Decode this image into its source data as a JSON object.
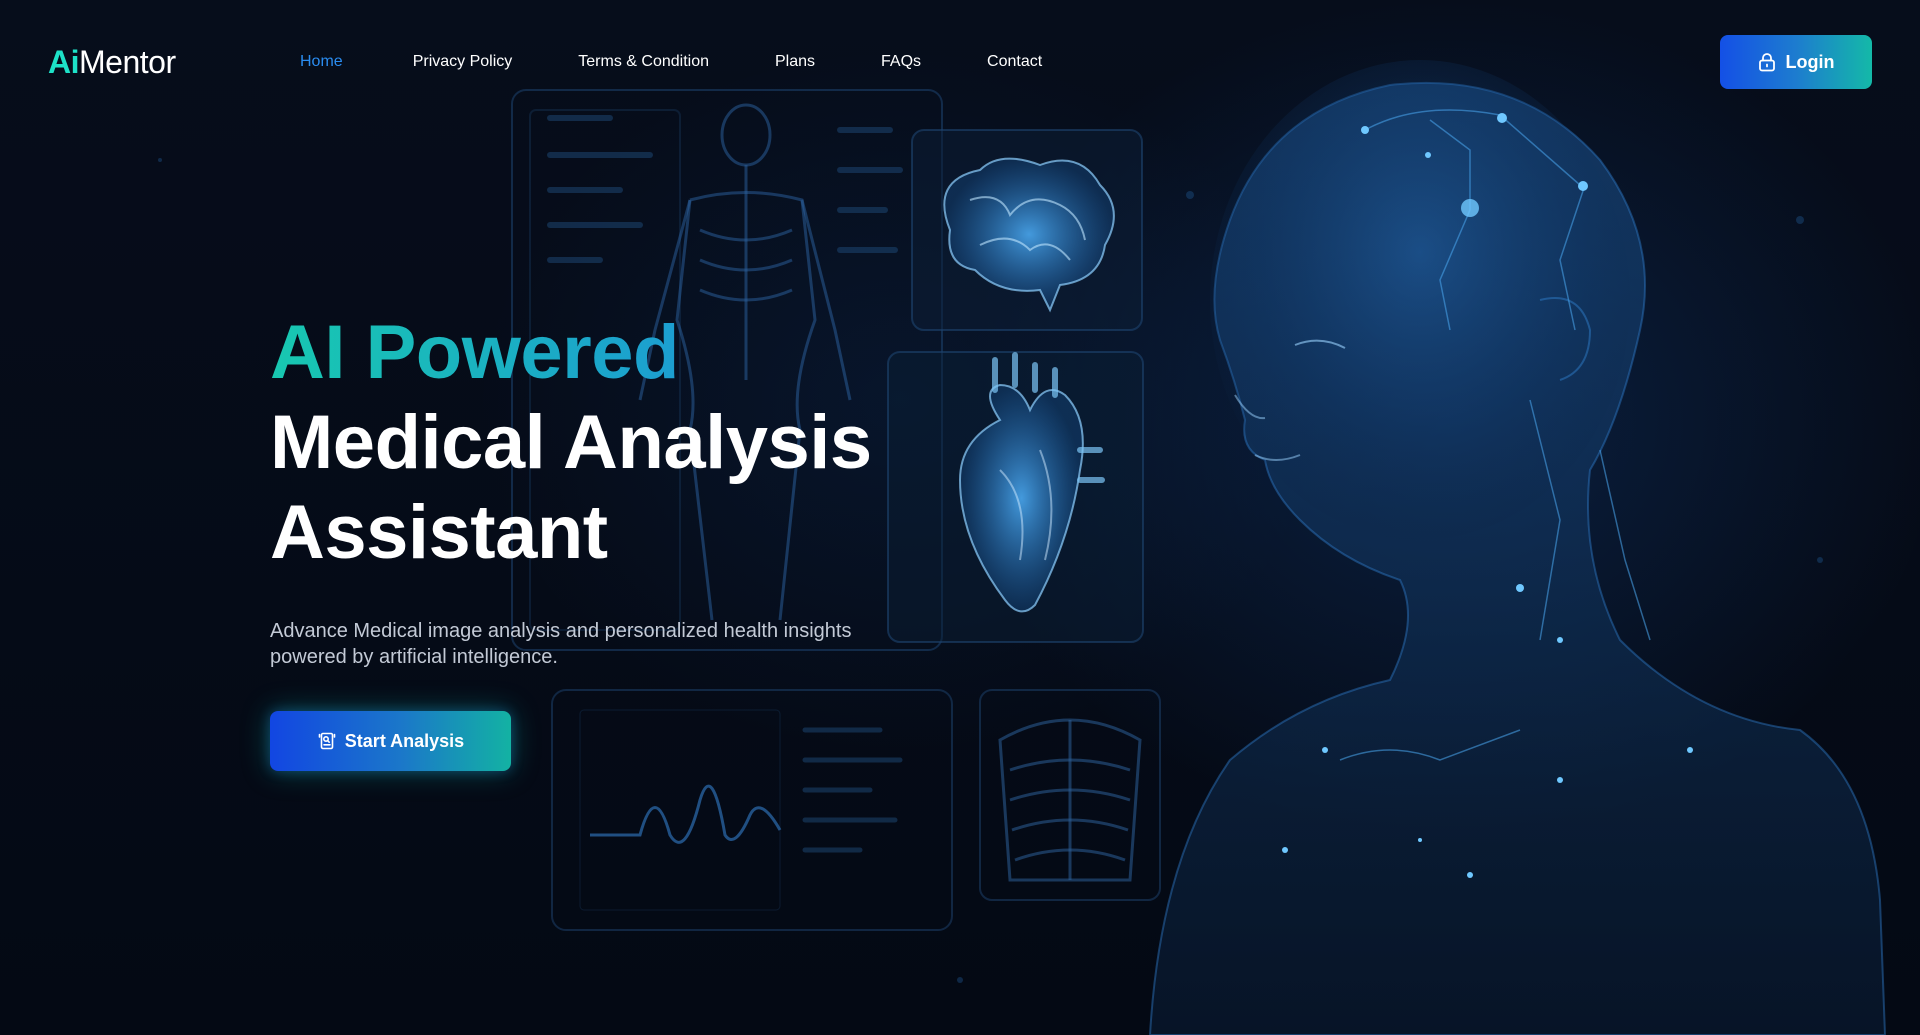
{
  "brand": {
    "logo_ai": "Ai",
    "logo_mentor": "Mentor"
  },
  "nav": {
    "items": [
      {
        "label": "Home",
        "active": true
      },
      {
        "label": "Privacy Policy"
      },
      {
        "label": "Terms & Condition"
      },
      {
        "label": "Plans"
      },
      {
        "label": "FAQs"
      },
      {
        "label": "Contact"
      }
    ]
  },
  "header": {
    "login_label": "Login",
    "login_icon": "lock-icon"
  },
  "hero": {
    "title_line1": "AI Powered",
    "title_line2": "Medical Analysis",
    "title_line3": "Assistant",
    "subtitle": "Advance Medical image analysis and personalized health insights powered by artificial intelligence.",
    "cta_label": "Start Analysis",
    "cta_icon": "document-scan-icon"
  },
  "colors": {
    "accent_teal": "#1de2c8",
    "accent_blue": "#1450e6",
    "nav_active": "#2a8cf0",
    "background": "#050b16"
  }
}
